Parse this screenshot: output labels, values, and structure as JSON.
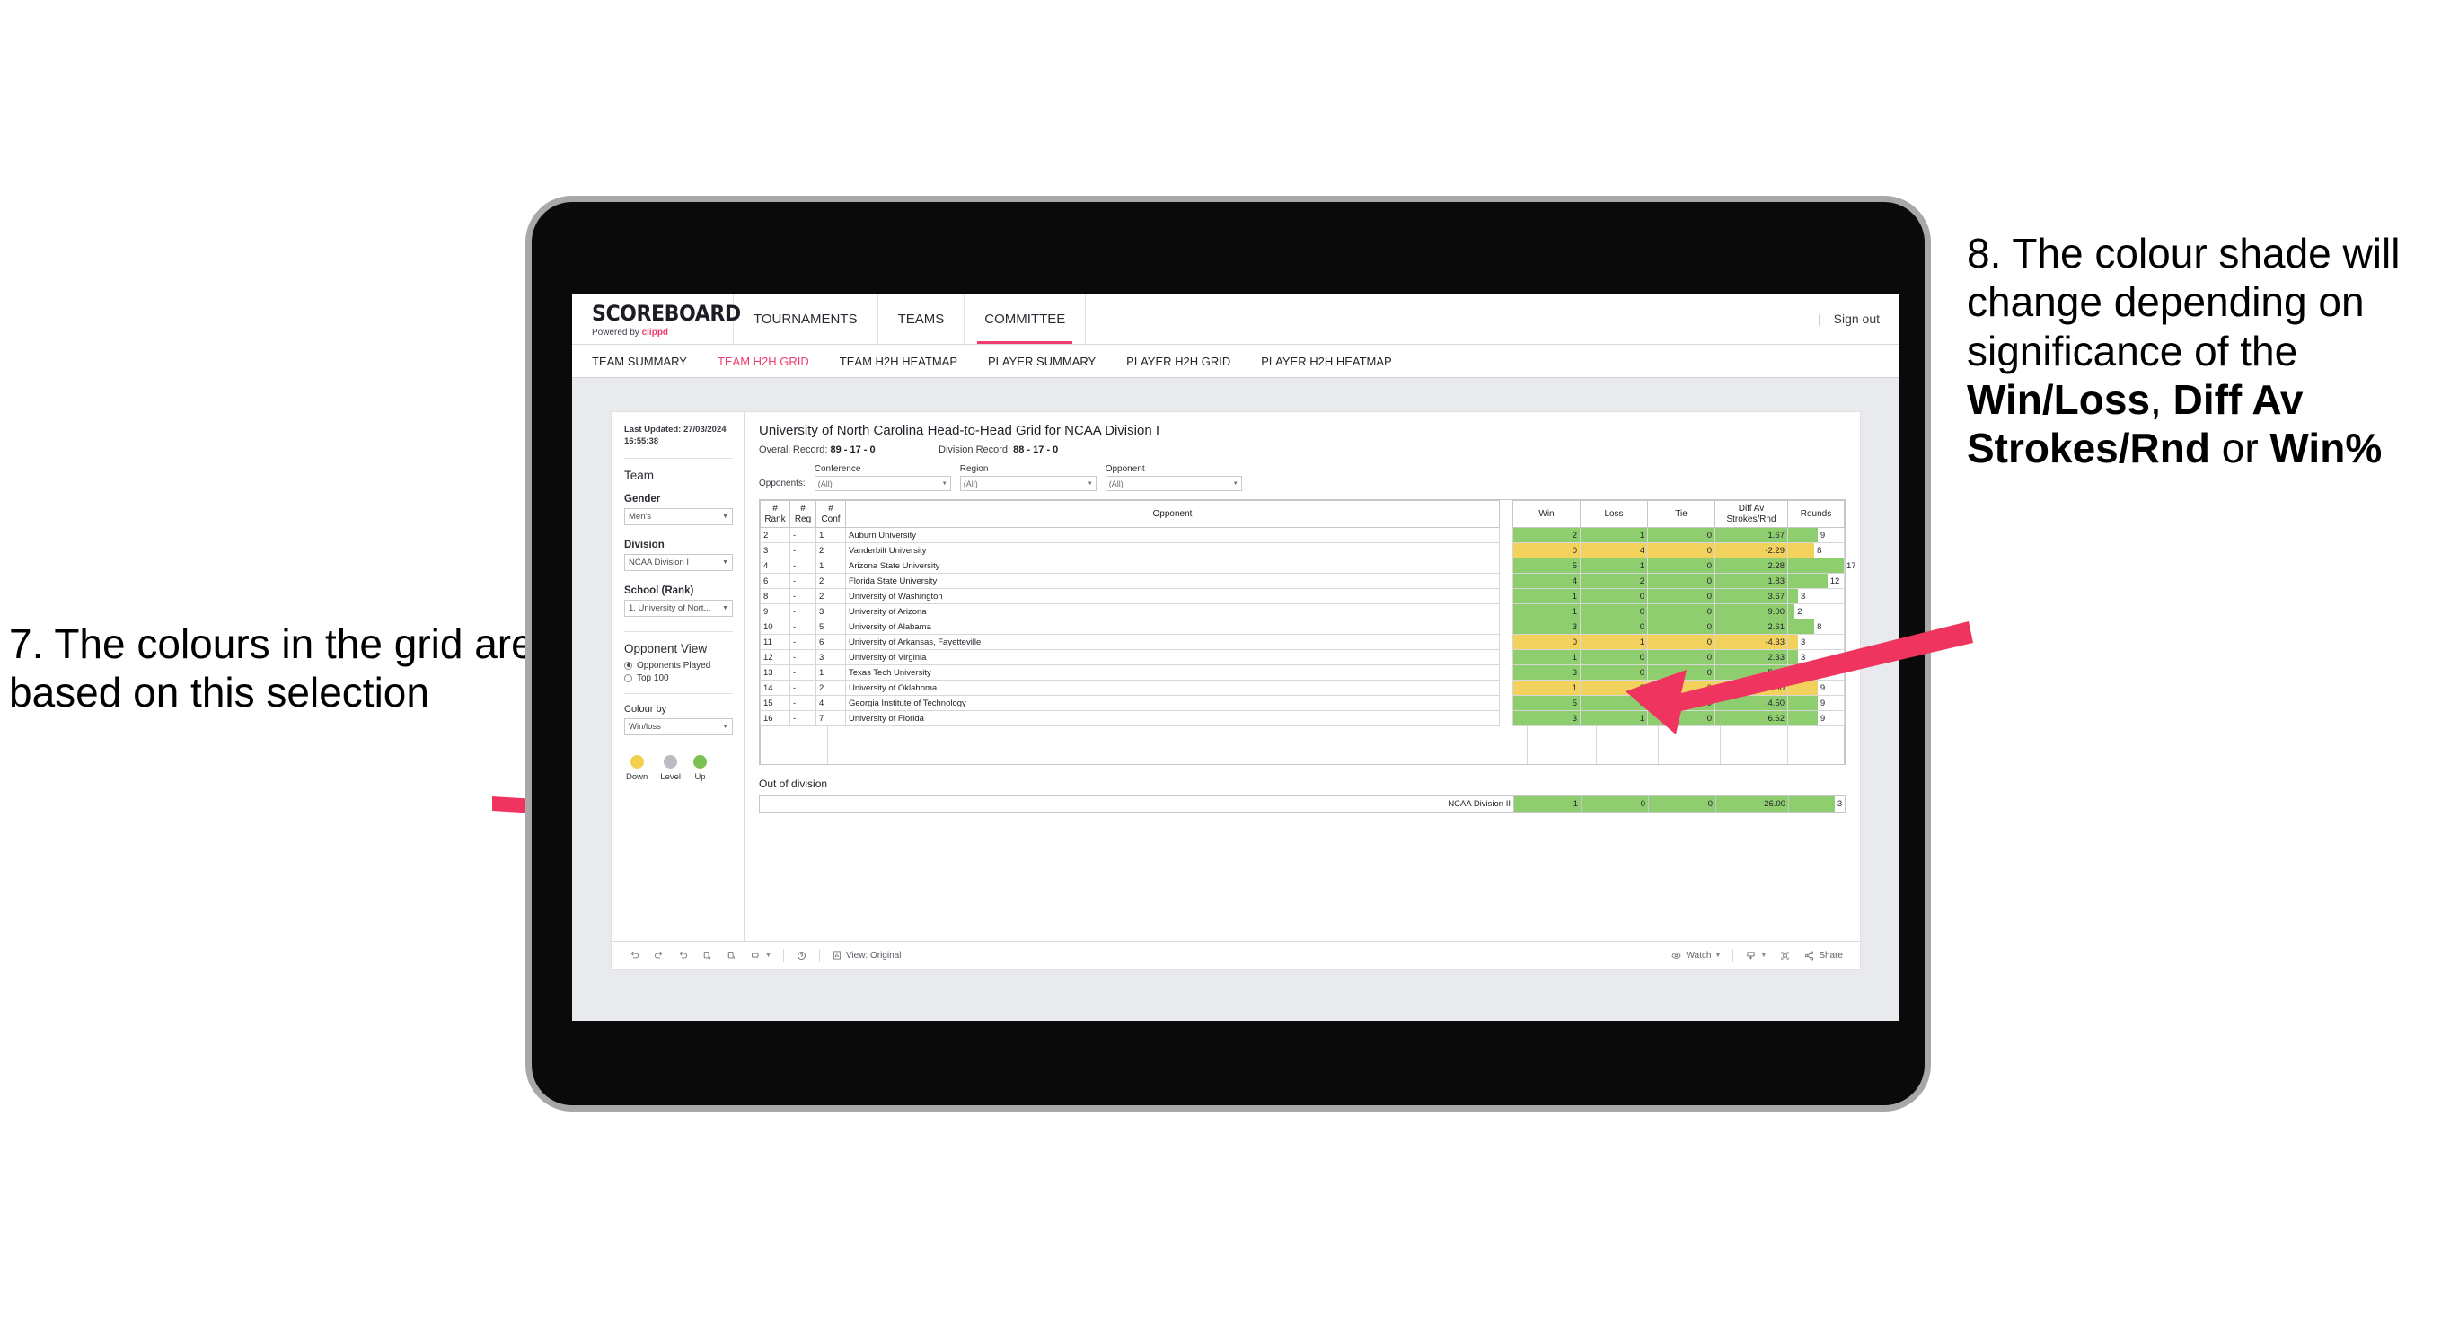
{
  "annotations": {
    "left": {
      "name": "annotation-7",
      "text": "7. The colours in the grid are based on this selection"
    },
    "right": {
      "name": "annotation-8",
      "prefix": "8. The colour shade will change depending on significance of the ",
      "bold1": "Win/Loss",
      "mid1": ", ",
      "bold2": "Diff Av Strokes/Rnd",
      "mid2": " or ",
      "bold3": "Win%"
    },
    "arrow_color": "#ef3460"
  },
  "app": {
    "brand": {
      "logo": "SCOREBOARD",
      "powered_prefix": "Powered by ",
      "powered_name": "clippd"
    },
    "topnav": [
      {
        "label": "TOURNAMENTS",
        "active": false
      },
      {
        "label": "TEAMS",
        "active": false
      },
      {
        "label": "COMMITTEE",
        "active": true
      }
    ],
    "signout": {
      "divider": "|",
      "label": "Sign out"
    },
    "subnav": [
      {
        "label": "TEAM SUMMARY",
        "active": false
      },
      {
        "label": "TEAM H2H GRID",
        "active": true
      },
      {
        "label": "TEAM H2H HEATMAP",
        "active": false
      },
      {
        "label": "PLAYER SUMMARY",
        "active": false
      },
      {
        "label": "PLAYER H2H GRID",
        "active": false
      },
      {
        "label": "PLAYER H2H HEATMAP",
        "active": false
      }
    ],
    "accent": "#ef3e6d"
  },
  "sidebar": {
    "last_updated": "Last Updated: 27/03/2024 16:55:38",
    "team_heading": "Team",
    "filters": [
      {
        "label": "Gender",
        "value": "Men's"
      },
      {
        "label": "Division",
        "value": "NCAA Division I"
      },
      {
        "label": "School (Rank)",
        "value": "1. University of Nort..."
      }
    ],
    "opponent_view": {
      "heading": "Opponent View",
      "options": [
        {
          "label": "Opponents Played",
          "selected": true
        },
        {
          "label": "Top 100",
          "selected": false
        }
      ]
    },
    "colour_by": {
      "label": "Colour by",
      "value": "Win/loss"
    },
    "legend": [
      {
        "label": "Down",
        "color": "#f2cf4d"
      },
      {
        "label": "Level",
        "color": "#b9bcc2"
      },
      {
        "label": "Up",
        "color": "#7cc252"
      }
    ]
  },
  "viz": {
    "title": "University of North Carolina Head-to-Head Grid for NCAA Division I",
    "overall_record_label": "Overall Record: ",
    "overall_record": "89 - 17 - 0",
    "division_record_label": "Division Record: ",
    "division_record": "88 - 17 - 0",
    "opponents_label": "Opponents:",
    "opponent_filters": [
      {
        "label": "Conference",
        "value": "(All)"
      },
      {
        "label": "Region",
        "value": "(All)"
      },
      {
        "label": "Opponent",
        "value": "(All)"
      }
    ],
    "out_of_division_title": "Out of division",
    "out_of_division_row": {
      "name": "NCAA Division II",
      "win": "1",
      "loss": "0",
      "tie": "0",
      "diff": "26.00",
      "rounds": "3",
      "state": "win"
    }
  },
  "chart_data": {
    "type": "table",
    "title": "University of North Carolina Head-to-Head Grid for NCAA Division I",
    "columns": [
      "# Rank",
      "# Reg",
      "# Conf",
      "Opponent",
      "Win",
      "Loss",
      "Tie",
      "Diff Av Strokes/Rnd",
      "Rounds"
    ],
    "rounds_max": 17,
    "colors": {
      "win": "#8fce6f",
      "loss": "#f2d15c"
    },
    "rows": [
      {
        "rank": "2",
        "reg": "-",
        "conf": "1",
        "opponent": "Auburn University",
        "win": "2",
        "loss": "1",
        "tie": "0",
        "diff": "1.67",
        "rounds": "9",
        "state": "win"
      },
      {
        "rank": "3",
        "reg": "-",
        "conf": "2",
        "opponent": "Vanderbilt University",
        "win": "0",
        "loss": "4",
        "tie": "0",
        "diff": "-2.29",
        "rounds": "8",
        "state": "loss"
      },
      {
        "rank": "4",
        "reg": "-",
        "conf": "1",
        "opponent": "Arizona State University",
        "win": "5",
        "loss": "1",
        "tie": "0",
        "diff": "2.28",
        "rounds": "17",
        "state": "win"
      },
      {
        "rank": "6",
        "reg": "-",
        "conf": "2",
        "opponent": "Florida State University",
        "win": "4",
        "loss": "2",
        "tie": "0",
        "diff": "1.83",
        "rounds": "12",
        "state": "win"
      },
      {
        "rank": "8",
        "reg": "-",
        "conf": "2",
        "opponent": "University of Washington",
        "win": "1",
        "loss": "0",
        "tie": "0",
        "diff": "3.67",
        "rounds": "3",
        "state": "win"
      },
      {
        "rank": "9",
        "reg": "-",
        "conf": "3",
        "opponent": "University of Arizona",
        "win": "1",
        "loss": "0",
        "tie": "0",
        "diff": "9.00",
        "rounds": "2",
        "state": "win"
      },
      {
        "rank": "10",
        "reg": "-",
        "conf": "5",
        "opponent": "University of Alabama",
        "win": "3",
        "loss": "0",
        "tie": "0",
        "diff": "2.61",
        "rounds": "8",
        "state": "win"
      },
      {
        "rank": "11",
        "reg": "-",
        "conf": "6",
        "opponent": "University of Arkansas, Fayetteville",
        "win": "0",
        "loss": "1",
        "tie": "0",
        "diff": "-4.33",
        "rounds": "3",
        "state": "loss"
      },
      {
        "rank": "12",
        "reg": "-",
        "conf": "3",
        "opponent": "University of Virginia",
        "win": "1",
        "loss": "0",
        "tie": "0",
        "diff": "2.33",
        "rounds": "3",
        "state": "win"
      },
      {
        "rank": "13",
        "reg": "-",
        "conf": "1",
        "opponent": "Texas Tech University",
        "win": "3",
        "loss": "0",
        "tie": "0",
        "diff": "5.56",
        "rounds": "9",
        "state": "win"
      },
      {
        "rank": "14",
        "reg": "-",
        "conf": "2",
        "opponent": "University of Oklahoma",
        "win": "1",
        "loss": "2",
        "tie": "0",
        "diff": "-1.00",
        "rounds": "9",
        "state": "loss"
      },
      {
        "rank": "15",
        "reg": "-",
        "conf": "4",
        "opponent": "Georgia Institute of Technology",
        "win": "5",
        "loss": "0",
        "tie": "0",
        "diff": "4.50",
        "rounds": "9",
        "state": "win"
      },
      {
        "rank": "16",
        "reg": "-",
        "conf": "7",
        "opponent": "University of Florida",
        "win": "3",
        "loss": "1",
        "tie": "0",
        "diff": "6.62",
        "rounds": "9",
        "state": "win"
      }
    ]
  },
  "toolbar": {
    "view_label": "View: Original",
    "watch_label": "Watch",
    "share_label": "Share"
  }
}
